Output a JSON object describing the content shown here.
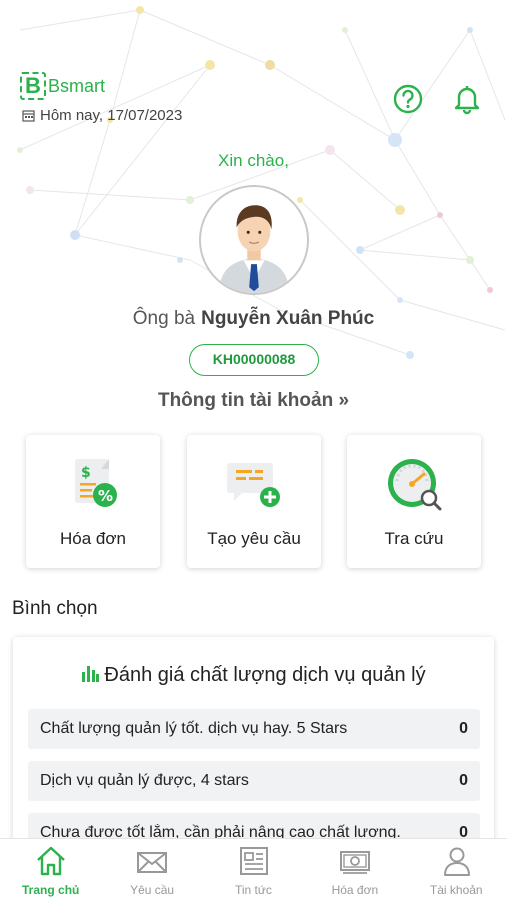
{
  "header": {
    "logo_letter": "B",
    "brand": "Bsmart",
    "date": "Hôm nay, 17/07/2023",
    "accent": "#2bb24c"
  },
  "profile": {
    "greeting": "Xin chào,",
    "salutation": "Ông bà",
    "name": "Nguyễn Xuân Phúc",
    "customer_code": "KH00000088",
    "account_link": "Thông tin tài khoản »"
  },
  "quick_actions": [
    {
      "label": "Hóa đơn",
      "icon": "invoice-percent-icon"
    },
    {
      "label": "Tạo yêu cầu",
      "icon": "create-request-icon"
    },
    {
      "label": "Tra cứu",
      "icon": "lookup-gauge-icon"
    }
  ],
  "poll": {
    "section_title": "Bình chọn",
    "title": "Đánh giá chất lượng dịch vụ quản lý",
    "options": [
      {
        "text": "Chất lượng quản lý tốt. dịch vụ hay. 5 Stars",
        "count": "0"
      },
      {
        "text": "Dịch vụ quản lý được, 4 stars",
        "count": "0"
      },
      {
        "text": "Chưa được tốt lắm, cần phải nâng cao chất lượng.",
        "count": "0"
      }
    ]
  },
  "nav": [
    {
      "label": "Trang chủ",
      "icon": "home-icon",
      "active": true
    },
    {
      "label": "Yêu cầu",
      "icon": "envelope-icon",
      "active": false
    },
    {
      "label": "Tin tức",
      "icon": "news-icon",
      "active": false
    },
    {
      "label": "Hóa đơn",
      "icon": "banknote-icon",
      "active": false
    },
    {
      "label": "Tài khoản",
      "icon": "user-icon",
      "active": false
    }
  ]
}
